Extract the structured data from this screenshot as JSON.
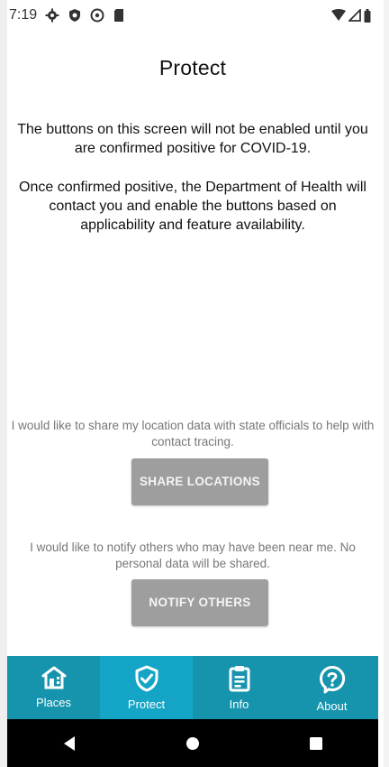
{
  "status_bar": {
    "time": "7:19",
    "icons_left": [
      "settings-icon",
      "shield-status-icon",
      "at-sign-icon",
      "sd-card-icon"
    ],
    "icons_right": [
      "wifi-icon",
      "signal-icon",
      "battery-icon"
    ]
  },
  "page": {
    "title": "Protect",
    "description_1": "The buttons on this screen will not be enabled until you are confirmed positive for COVID-19.",
    "description_2": "Once confirmed positive, the Department of Health will contact you and enable the buttons based on applicability and feature availability."
  },
  "actions": {
    "share": {
      "text": "I would like to share my location data with state officials to help with contact tracing.",
      "button_label": "SHARE LOCATIONS"
    },
    "notify": {
      "text": "I would like to notify others who may have been near me. No personal data will be shared.",
      "button_label": "NOTIFY OTHERS"
    }
  },
  "tabs": [
    {
      "label": "Places",
      "icon": "home-icon",
      "active": false
    },
    {
      "label": "Protect",
      "icon": "shield-check-icon",
      "active": true
    },
    {
      "label": "Info",
      "icon": "clipboard-icon",
      "active": false
    },
    {
      "label": "About",
      "icon": "help-bubble-icon",
      "active": false
    }
  ],
  "colors": {
    "tab_bar": "#1694ad",
    "tab_active": "#14a5c6",
    "disabled_button": "#9e9e9e"
  }
}
